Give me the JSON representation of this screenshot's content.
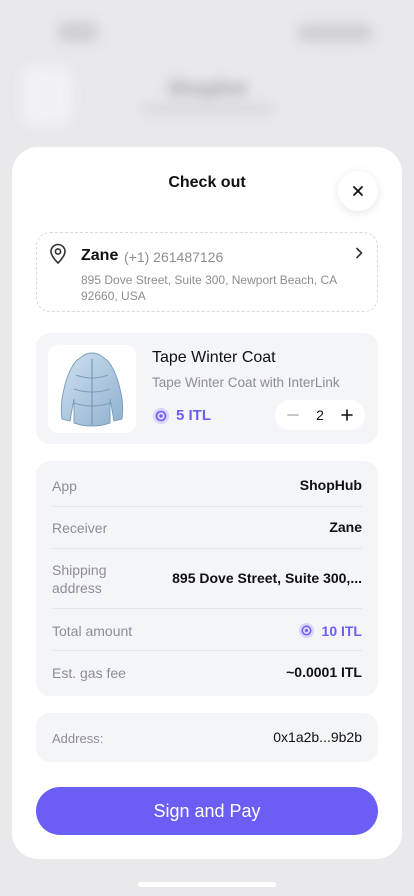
{
  "background": {
    "title": "Shoplist"
  },
  "sheet": {
    "title": "Check out",
    "close_icon": "close-icon"
  },
  "address": {
    "name": "Zane",
    "phone": "(+1) 261487126",
    "lines": "895 Dove Street, Suite 300, Newport Beach, CA 92660, USA",
    "icon": "location-pin-icon"
  },
  "product": {
    "name": "Tape Winter Coat",
    "description": "Tape Winter Coat with InterLink",
    "price": "5 ITL",
    "quantity": "2"
  },
  "details": {
    "rows": [
      {
        "key": "App",
        "value": "ShopHub"
      },
      {
        "key": "Receiver",
        "value": "Zane"
      },
      {
        "key": "Shipping address",
        "value": "895 Dove Street, Suite 300,..."
      },
      {
        "key": "Total amount",
        "value": "10 ITL"
      },
      {
        "key": "Est. gas fee",
        "value": "~0.0001 ITL"
      }
    ]
  },
  "wallet": {
    "label": "Address:",
    "value": "0x1a2b...9b2b"
  },
  "actions": {
    "pay_label": "Sign and Pay"
  },
  "colors": {
    "accent": "#6b5ef5",
    "card_bg": "#f4f5f9",
    "muted_text": "#8d8d93"
  }
}
